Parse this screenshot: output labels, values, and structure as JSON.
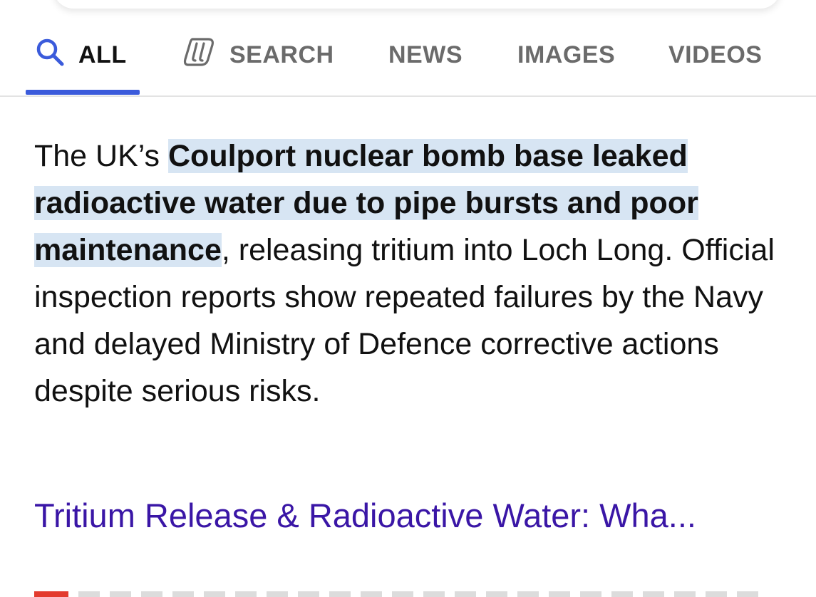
{
  "tabs": [
    {
      "label": "ALL",
      "icon": "search-icon",
      "active": true
    },
    {
      "label": "SEARCH",
      "icon": "copilot-icon",
      "active": false
    },
    {
      "label": "NEWS",
      "active": false
    },
    {
      "label": "IMAGES",
      "active": false
    },
    {
      "label": "VIDEOS",
      "active": false
    }
  ],
  "answer": {
    "prefix": "The UK’s ",
    "highlight": "Coulport nuclear bomb base leaked radioactive water due to pipe bursts and poor maintenance",
    "rest": ", releasing tritium into Loch Long. Official inspection reports show repeated failures by the Navy and delayed Ministry of Defence corrective actions despite serious risks."
  },
  "result": {
    "title": "Tritium Release & Radioactive Water: Wha..."
  },
  "colors": {
    "active_tab_underline": "#3b5bdb",
    "highlight_bg": "#d7e5f3",
    "link": "#3a16a6",
    "favicon": "#e33b2e"
  }
}
